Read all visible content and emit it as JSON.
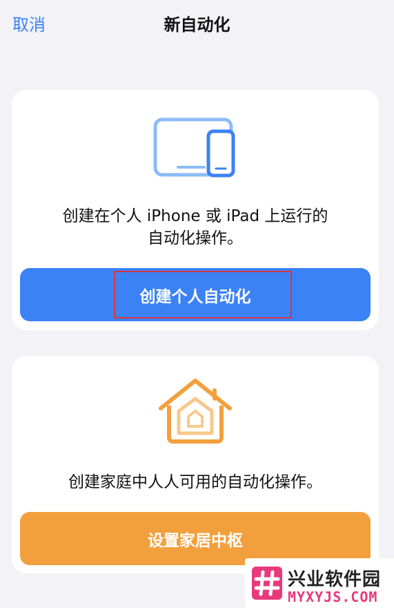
{
  "nav": {
    "cancel_label": "取消",
    "title": "新自动化"
  },
  "personal_card": {
    "icon": "iphone-ipad-icon",
    "description_line1": "创建在个人 iPhone 或 iPad 上运行的",
    "description_line2": "自动化操作。",
    "button_label": "创建个人自动化",
    "button_color": "#3b82f6"
  },
  "home_card": {
    "icon": "home-icon",
    "description": "创建家庭中人人可用的自动化操作。",
    "button_label": "设置家居中枢",
    "button_color": "#f2a03d"
  },
  "watermark": {
    "brand_cn": "兴业软件园",
    "brand_en": "MYXYJS.COM",
    "accent_color": "#e8397b"
  }
}
